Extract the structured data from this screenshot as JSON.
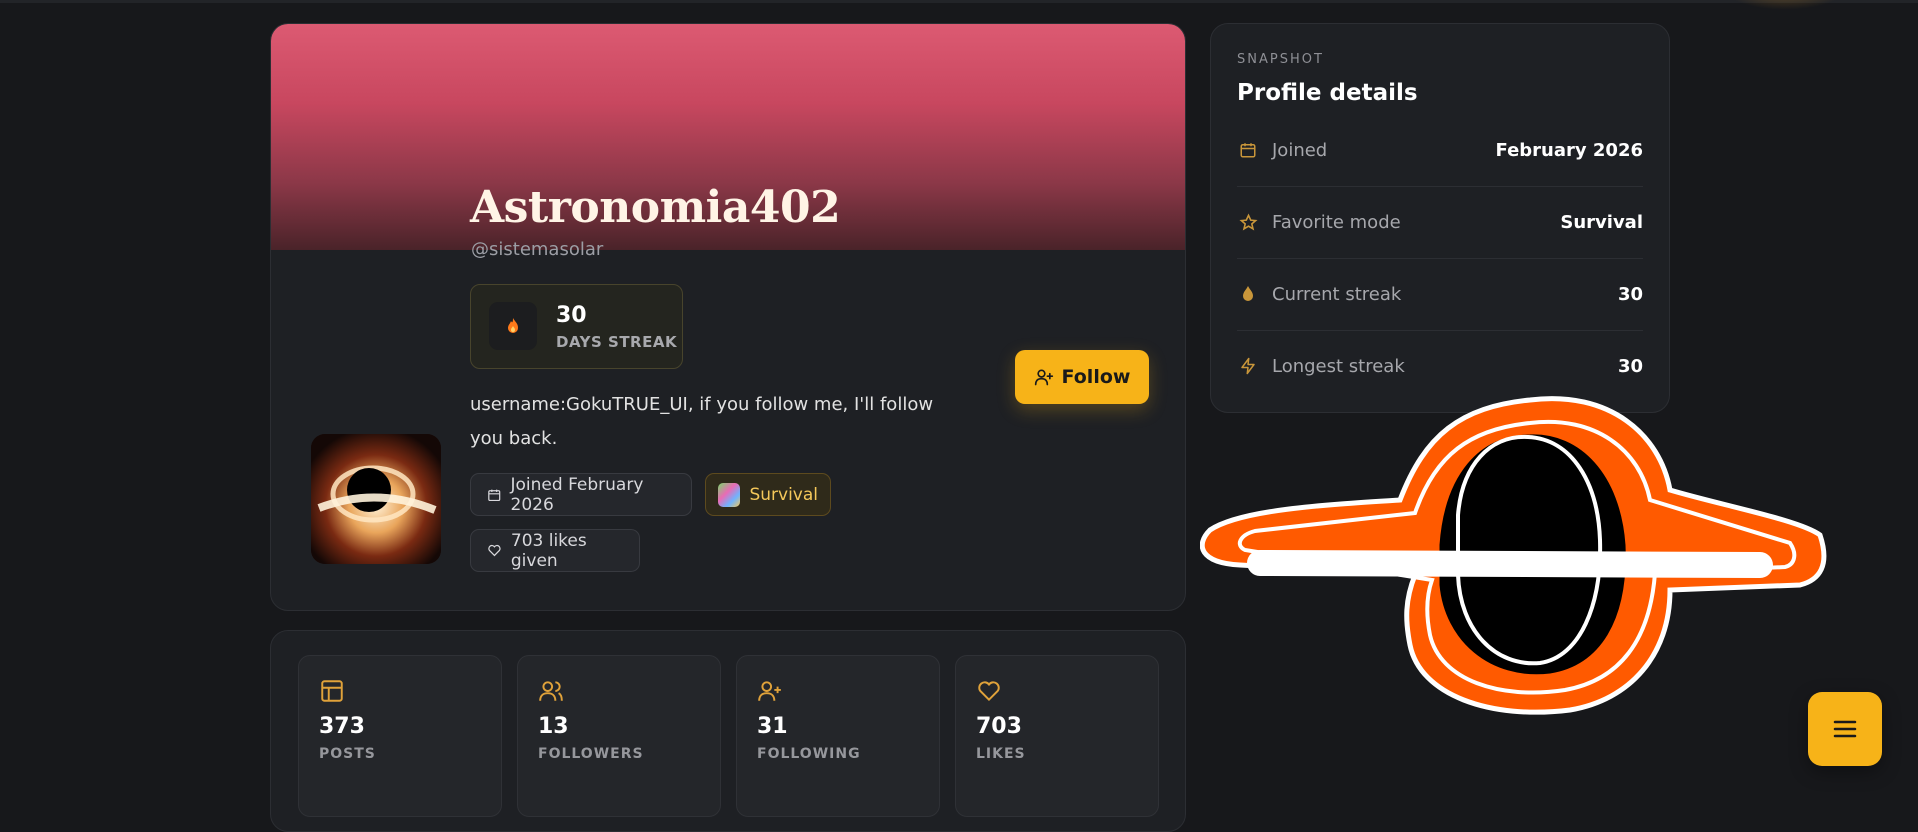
{
  "profile": {
    "display_name": "Astronomia402",
    "handle": "@sistemasolar",
    "streak": {
      "value": "30",
      "label": "DAYS STREAK"
    },
    "follow_label": "Follow",
    "bio": "username:GokuTRUE_UI, if you follow me, I'll follow you back.",
    "chips": {
      "joined": "Joined February 2026",
      "mode": "Survival",
      "likes": "703 likes given"
    }
  },
  "stats": [
    {
      "value": "373",
      "label": "POSTS",
      "icon": "posts-icon"
    },
    {
      "value": "13",
      "label": "FOLLOWERS",
      "icon": "followers-icon"
    },
    {
      "value": "31",
      "label": "FOLLOWING",
      "icon": "following-icon"
    },
    {
      "value": "703",
      "label": "LIKES",
      "icon": "likes-icon"
    }
  ],
  "snapshot": {
    "eyebrow": "SNAPSHOT",
    "title": "Profile details",
    "rows": [
      {
        "label": "Joined",
        "value": "February 2026",
        "icon": "calendar-icon"
      },
      {
        "label": "Favorite mode",
        "value": "Survival",
        "icon": "star-icon"
      },
      {
        "label": "Current streak",
        "value": "30",
        "icon": "flame-icon"
      },
      {
        "label": "Longest streak",
        "value": "30",
        "icon": "lightning-icon"
      }
    ]
  },
  "colors": {
    "accent": "#f7b318",
    "background": "#17181b",
    "card": "#1e2024",
    "banner_top": "#dc5a72"
  }
}
